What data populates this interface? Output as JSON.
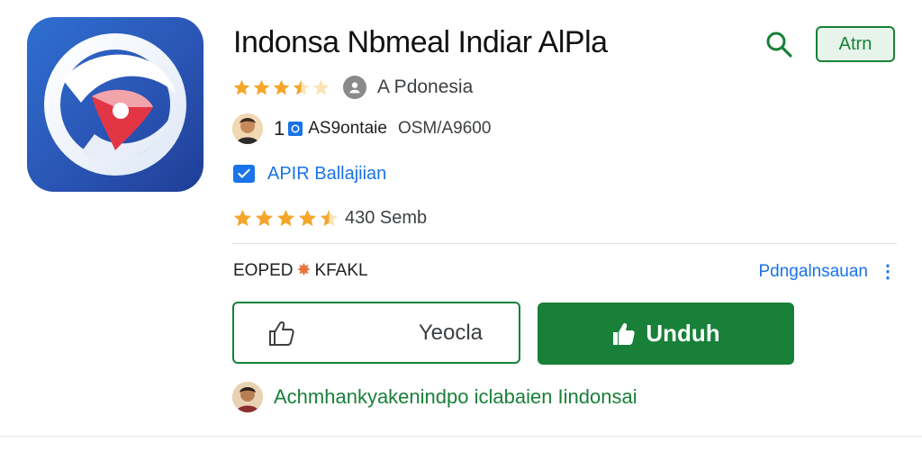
{
  "app": {
    "title": "Indonsa Nbmeal Indiar AlPla",
    "rating_stars": 3.5,
    "region": "A Pdonesia"
  },
  "developer": {
    "count": "1",
    "name": "AS9ontaie",
    "size": "OSM/A9600"
  },
  "category": {
    "label": "APIR Ballajiian"
  },
  "reviews": {
    "rating_stars": 4.5,
    "count_label": "430 Semb"
  },
  "section": {
    "label_left": "EOPED",
    "label_right": "KFAKL",
    "more_link": "Pdngalnsauan"
  },
  "header": {
    "button_label": "Atrn"
  },
  "actions": {
    "like_label": "Yeocla",
    "download_label": "Unduh"
  },
  "note": {
    "text": "Achmhankyakenindpo iclabaien Iindonsai"
  },
  "colors": {
    "accent_green": "#188038",
    "link_blue": "#1a73e8",
    "star": "#f4a62a"
  },
  "icons": {
    "search": "search-icon",
    "thumbs_up": "thumbs-up-icon",
    "download": "download-icon",
    "more": "more-vert-icon"
  }
}
